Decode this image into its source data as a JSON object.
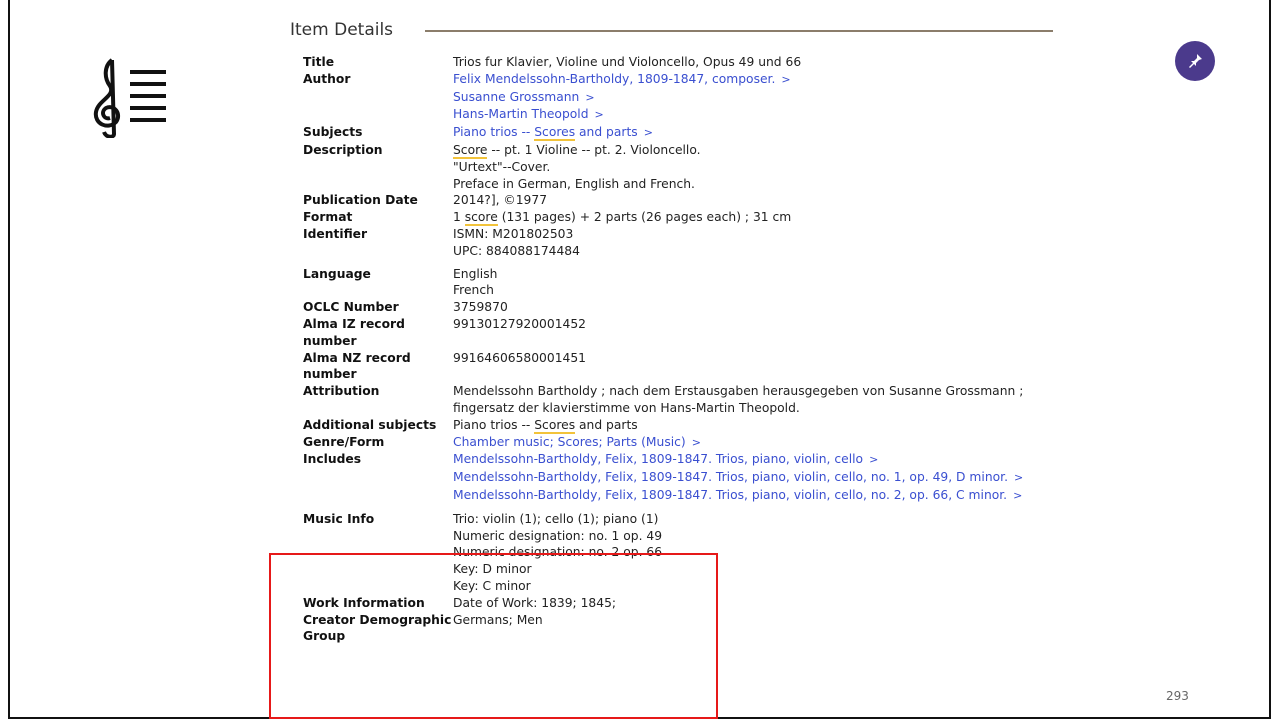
{
  "section": {
    "title": "Item Details"
  },
  "page_number": "293",
  "pin_icon": "pin-icon",
  "clef_icon": "treble-clef-list-icon",
  "fields": {
    "title": {
      "label": "Title",
      "value": "Trios fur Klavier, Violine und Violoncello, Opus 49 und 66"
    },
    "author": {
      "label": "Author",
      "values": [
        "Felix Mendelssohn-Bartholdy, 1809-1847, composer.",
        "Susanne Grossmann",
        "Hans-Martin Theopold"
      ]
    },
    "subjects": {
      "label": "Subjects",
      "prefix": "Piano trios -- ",
      "highlight": "Scores",
      "suffix": " and parts"
    },
    "description": {
      "label": "Description",
      "highlight": "Score",
      "line1_rest": " -- pt. 1 Violine -- pt. 2. Violoncello.",
      "line2": "\"Urtext\"--Cover.",
      "line3": "Preface in German, English and French."
    },
    "publication_date": {
      "label": "Publication Date",
      "value": "2014?], ©1977"
    },
    "format": {
      "label": "Format",
      "prefix": "1 ",
      "highlight": "score",
      "suffix": " (131 pages) + 2 parts (26 pages each) ; 31 cm"
    },
    "identifier": {
      "label": "Identifier",
      "line1": "ISMN: M201802503",
      "line2": "UPC: 884088174484"
    },
    "language": {
      "label": "Language",
      "line1": "English",
      "line2": "French"
    },
    "oclc": {
      "label": "OCLC Number",
      "value": "3759870"
    },
    "alma_iz": {
      "label_line1": "Alma IZ record",
      "label_line2": "number",
      "value": "99130127920001452"
    },
    "alma_nz": {
      "label_line1": "Alma NZ record",
      "label_line2": "number",
      "value": "99164606580001451"
    },
    "attribution": {
      "label": "Attribution",
      "line1": "Mendelssohn Bartholdy ; nach dem Erstausgaben herausgegeben von Susanne Grossmann ;",
      "line2": "fingersatz der klavierstimme von Hans-Martin Theopold."
    },
    "additional_subjects": {
      "label": "Additional subjects",
      "prefix": "Piano trios -- ",
      "highlight": "Scores",
      "suffix": " and parts"
    },
    "genre": {
      "label": "Genre/Form",
      "value": "Chamber music; Scores; Parts (Music)"
    },
    "includes": {
      "label": "Includes",
      "items": [
        "Mendelssohn-Bartholdy, Felix, 1809-1847. Trios, piano, violin, cello",
        "Mendelssohn-Bartholdy, Felix, 1809-1847. Trios, piano, violin, cello, no. 1, op. 49, D minor.",
        "Mendelssohn-Bartholdy, Felix, 1809-1847. Trios, piano, violin, cello, no. 2, op. 66, C minor."
      ]
    },
    "music_info": {
      "label": "Music Info",
      "lines": [
        "Trio: violin (1); cello (1); piano (1)",
        "Numeric designation: no. 1 op. 49",
        "Numeric designation: no. 2 op. 66",
        "Key: D minor",
        "Key: C minor"
      ]
    },
    "work_information": {
      "label": "Work Information",
      "value": "Date of Work: 1839; 1845;"
    },
    "creator_demographic": {
      "label_line1": "Creator Demographic",
      "label_line2": "Group",
      "value": "Germans; Men"
    }
  },
  "chevron": ">",
  "colors": {
    "link": "#3a4fd0",
    "highlight": "#f2c33a",
    "pin_bg": "#4b3a8c",
    "red_box": "#e61919"
  }
}
